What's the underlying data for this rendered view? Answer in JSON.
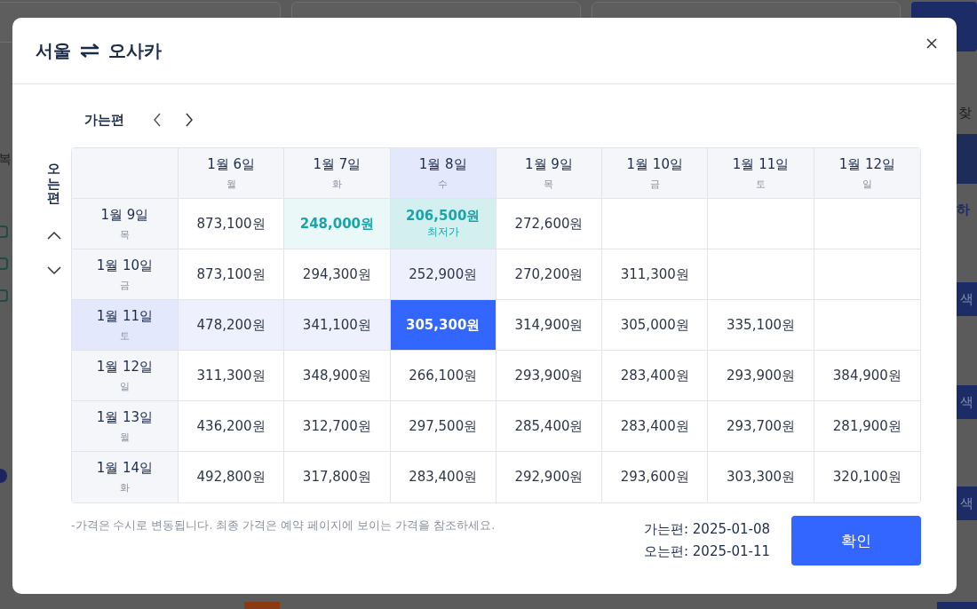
{
  "background": {
    "left_texts": [
      "복"
    ],
    "right_texts": [
      "찾",
      "하"
    ],
    "right_buttons": [
      "색",
      "색",
      "색"
    ]
  },
  "dialog": {
    "title_from": "서울",
    "title_to": "오사카",
    "outbound_label": "가는편",
    "return_label": "오는편",
    "columns": [
      {
        "date": "1월 6일",
        "day": "월",
        "selected": false
      },
      {
        "date": "1월 7일",
        "day": "화",
        "selected": false
      },
      {
        "date": "1월 8일",
        "day": "수",
        "selected": true
      },
      {
        "date": "1월 9일",
        "day": "목",
        "selected": false
      },
      {
        "date": "1월 10일",
        "day": "금",
        "selected": false
      },
      {
        "date": "1월 11일",
        "day": "토",
        "selected": false
      },
      {
        "date": "1월 12일",
        "day": "일",
        "selected": false
      }
    ],
    "rows": [
      {
        "date": "1월 9일",
        "day": "목",
        "selected": false,
        "cells": [
          {
            "price": "873,100원"
          },
          {
            "price": "248,000원",
            "cheap": true
          },
          {
            "price": "206,500원",
            "cheap": true,
            "lowest": true,
            "tag": "최저가"
          },
          {
            "price": "272,600원"
          }
        ]
      },
      {
        "date": "1월 10일",
        "day": "금",
        "selected": false,
        "cells": [
          {
            "price": "873,100원"
          },
          {
            "price": "294,300원"
          },
          {
            "price": "252,900원"
          },
          {
            "price": "270,200원"
          },
          {
            "price": "311,300원"
          }
        ]
      },
      {
        "date": "1월 11일",
        "day": "토",
        "selected": true,
        "cells": [
          {
            "price": "478,200원"
          },
          {
            "price": "341,100원"
          },
          {
            "price": "305,300원"
          },
          {
            "price": "314,900원"
          },
          {
            "price": "305,000원"
          },
          {
            "price": "335,100원"
          }
        ]
      },
      {
        "date": "1월 12일",
        "day": "일",
        "selected": false,
        "cells": [
          {
            "price": "311,300원"
          },
          {
            "price": "348,900원"
          },
          {
            "price": "266,100원"
          },
          {
            "price": "293,900원"
          },
          {
            "price": "283,400원"
          },
          {
            "price": "293,900원"
          },
          {
            "price": "384,900원"
          }
        ]
      },
      {
        "date": "1월 13일",
        "day": "월",
        "selected": false,
        "cells": [
          {
            "price": "436,200원"
          },
          {
            "price": "312,700원"
          },
          {
            "price": "297,500원"
          },
          {
            "price": "285,400원"
          },
          {
            "price": "283,400원"
          },
          {
            "price": "293,700원"
          },
          {
            "price": "281,900원"
          }
        ]
      },
      {
        "date": "1월 14일",
        "day": "화",
        "selected": false,
        "cells": [
          {
            "price": "492,800원"
          },
          {
            "price": "317,800원"
          },
          {
            "price": "283,400원"
          },
          {
            "price": "292,900원"
          },
          {
            "price": "293,600원"
          },
          {
            "price": "303,300원"
          },
          {
            "price": "320,100원"
          }
        ]
      }
    ],
    "note": "-가격은 수시로 변동됩니다. 최종 가격은 예약 페이지에 보이는 가격을 참조하세요.",
    "summary": [
      "가는편: 2025-01-08",
      "오는편: 2025-01-11"
    ],
    "confirm": "확인"
  }
}
